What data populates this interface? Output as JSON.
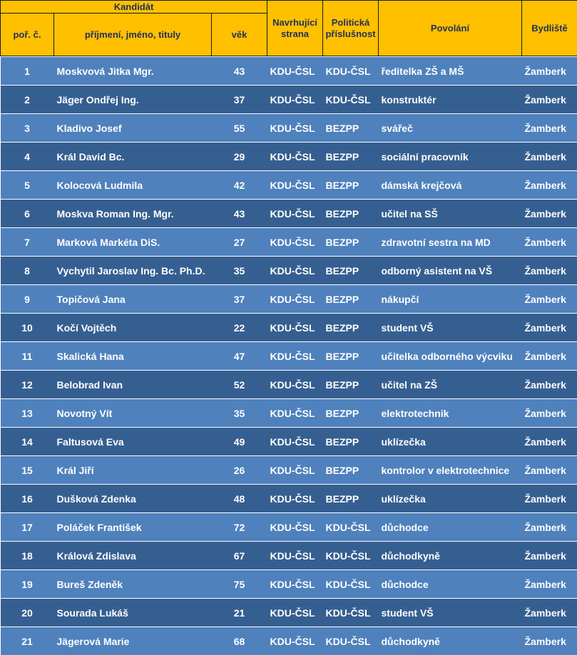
{
  "header": {
    "group_label": "Kandidát",
    "col_num": "poř. č.",
    "col_name": "příjmení, jméno, tituly",
    "col_age": "věk",
    "col_party": "Navrhující strana",
    "col_affil": "Politická příslušnost",
    "col_job": "Povolání",
    "col_residence": "Bydliště"
  },
  "colors": {
    "header_bg": "#ffc000",
    "header_text": "#1f2f5a",
    "row_light": "#4f81bd",
    "row_dark": "#365f91",
    "row_text": "#ffffff"
  },
  "rows": [
    {
      "num": "1",
      "name": "Moskvová Jitka Mgr.",
      "age": "43",
      "party": "KDU-ČSL",
      "affil": "KDU-ČSL",
      "job": "ředitelka ZŠ a MŠ",
      "residence": "Žamberk"
    },
    {
      "num": "2",
      "name": "Jäger Ondřej Ing.",
      "age": "37",
      "party": "KDU-ČSL",
      "affil": "KDU-ČSL",
      "job": "konstruktér",
      "residence": "Žamberk"
    },
    {
      "num": "3",
      "name": "Kladivo Josef",
      "age": "55",
      "party": "KDU-ČSL",
      "affil": "BEZPP",
      "job": "svářeč",
      "residence": "Žamberk"
    },
    {
      "num": "4",
      "name": "Král David Bc.",
      "age": "29",
      "party": "KDU-ČSL",
      "affil": "BEZPP",
      "job": "sociální pracovník",
      "residence": "Žamberk"
    },
    {
      "num": "5",
      "name": "Kolocová Ludmila",
      "age": "42",
      "party": "KDU-ČSL",
      "affil": "BEZPP",
      "job": "dámská krejčová",
      "residence": "Žamberk"
    },
    {
      "num": "6",
      "name": "Moskva Roman Ing. Mgr.",
      "age": "43",
      "party": "KDU-ČSL",
      "affil": "BEZPP",
      "job": "učitel na SŠ",
      "residence": "Žamberk"
    },
    {
      "num": "7",
      "name": "Marková Markéta DiS.",
      "age": "27",
      "party": "KDU-ČSL",
      "affil": "BEZPP",
      "job": "zdravotní sestra na MD",
      "residence": "Žamberk"
    },
    {
      "num": "8",
      "name": "Vychytil Jaroslav Ing. Bc. Ph.D.",
      "age": "35",
      "party": "KDU-ČSL",
      "affil": "BEZPP",
      "job": "odborný asistent na VŠ",
      "residence": "Žamberk"
    },
    {
      "num": "9",
      "name": "Topičová Jana",
      "age": "37",
      "party": "KDU-ČSL",
      "affil": "BEZPP",
      "job": "nákupčí",
      "residence": "Žamberk"
    },
    {
      "num": "10",
      "name": "Kočí Vojtěch",
      "age": "22",
      "party": "KDU-ČSL",
      "affil": "BEZPP",
      "job": "student VŠ",
      "residence": "Žamberk"
    },
    {
      "num": "11",
      "name": "Skalická Hana",
      "age": "47",
      "party": "KDU-ČSL",
      "affil": "BEZPP",
      "job": "učitelka odborného výcviku",
      "residence": "Žamberk"
    },
    {
      "num": "12",
      "name": "Belobrad Ivan",
      "age": "52",
      "party": "KDU-ČSL",
      "affil": "BEZPP",
      "job": "učitel na ZŠ",
      "residence": "Žamberk"
    },
    {
      "num": "13",
      "name": "Novotný Vít",
      "age": "35",
      "party": "KDU-ČSL",
      "affil": "BEZPP",
      "job": "elektrotechnik",
      "residence": "Žamberk"
    },
    {
      "num": "14",
      "name": "Faltusová Eva",
      "age": "49",
      "party": "KDU-ČSL",
      "affil": "BEZPP",
      "job": "uklízečka",
      "residence": "Žamberk"
    },
    {
      "num": "15",
      "name": "Král Jiří",
      "age": "26",
      "party": "KDU-ČSL",
      "affil": "BEZPP",
      "job": "kontrolor v elektrotechnice",
      "residence": "Žamberk"
    },
    {
      "num": "16",
      "name": "Dušková Zdenka",
      "age": "48",
      "party": "KDU-ČSL",
      "affil": "BEZPP",
      "job": "uklízečka",
      "residence": "Žamberk"
    },
    {
      "num": "17",
      "name": "Poláček František",
      "age": "72",
      "party": "KDU-ČSL",
      "affil": "KDU-ČSL",
      "job": "důchodce",
      "residence": "Žamberk"
    },
    {
      "num": "18",
      "name": "Králová Zdislava",
      "age": "67",
      "party": "KDU-ČSL",
      "affil": "KDU-ČSL",
      "job": "důchodkyně",
      "residence": "Žamberk"
    },
    {
      "num": "19",
      "name": "Bureš Zdeněk",
      "age": "75",
      "party": "KDU-ČSL",
      "affil": "KDU-ČSL",
      "job": "důchodce",
      "residence": "Žamberk"
    },
    {
      "num": "20",
      "name": "Sourada Lukáš",
      "age": "21",
      "party": "KDU-ČSL",
      "affil": "KDU-ČSL",
      "job": "student VŠ",
      "residence": "Žamberk"
    },
    {
      "num": "21",
      "name": "Jägerová Marie",
      "age": "68",
      "party": "KDU-ČSL",
      "affil": "KDU-ČSL",
      "job": "důchodkyně",
      "residence": "Žamberk"
    }
  ]
}
